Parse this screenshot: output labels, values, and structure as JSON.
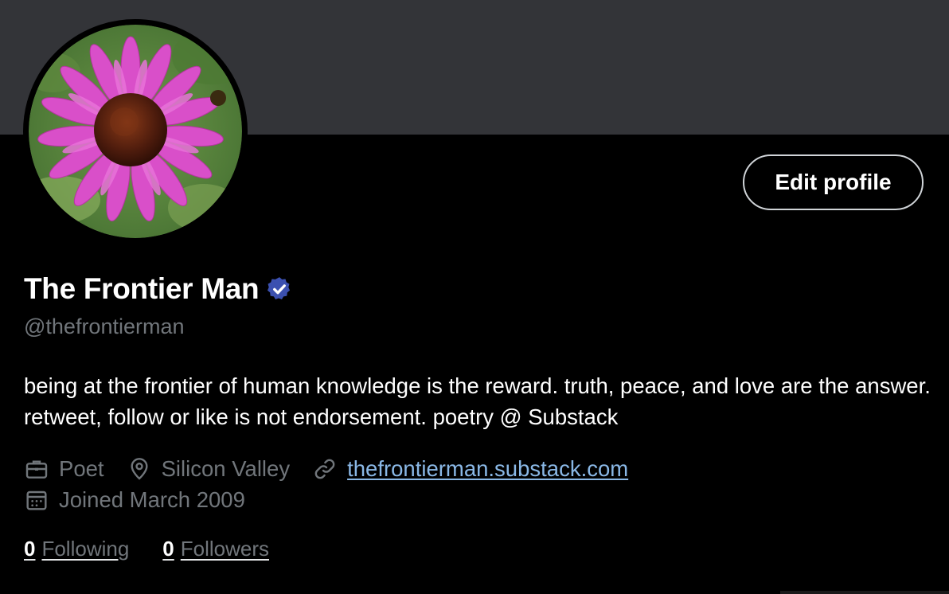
{
  "profile": {
    "display_name": "The Frontier Man",
    "handle": "@thefrontierman",
    "bio": "being at the frontier of human knowledge is the reward. truth, peace, and love are the answer. retweet, follow or like is not endorsement. poetry @ Substack",
    "occupation": "Poet",
    "location": "Silicon Valley",
    "website": "thefrontierman.substack.com",
    "joined": "Joined March 2009",
    "verified": true
  },
  "actions": {
    "edit_profile_label": "Edit profile"
  },
  "stats": {
    "following_count": "0",
    "following_label": "Following",
    "followers_count": "0",
    "followers_label": "Followers"
  },
  "icons": {
    "verified_badge": "verified-badge-icon",
    "occupation": "briefcase-icon",
    "location": "location-pin-icon",
    "website": "link-icon",
    "joined": "calendar-icon"
  },
  "colors": {
    "background": "#000000",
    "banner": "#333438",
    "verified": "#3b50b0",
    "link": "#8ab8e6",
    "muted_text": "#71767b"
  }
}
